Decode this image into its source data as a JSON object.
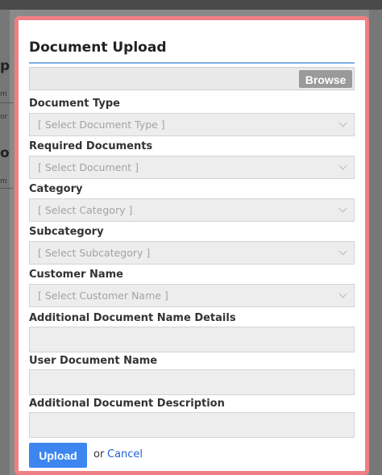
{
  "background": {
    "fragments": [
      "p",
      "o"
    ],
    "small_fragments": [
      "m",
      "or",
      "m"
    ]
  },
  "modal": {
    "title": "Document Upload",
    "file_input": {
      "value": "",
      "browse_label": "Browse"
    },
    "fields": [
      {
        "label": "Document Type",
        "kind": "select",
        "placeholder": "[ Select Document Type ]"
      },
      {
        "label": "Required Documents",
        "kind": "select",
        "placeholder": "[ Select Document ]"
      },
      {
        "label": "Category",
        "kind": "select",
        "placeholder": "[ Select Category ]"
      },
      {
        "label": "Subcategory",
        "kind": "select",
        "placeholder": "[ Select Subcategory ]"
      },
      {
        "label": "Customer Name",
        "kind": "select",
        "placeholder": "[ Select Customer Name ]"
      },
      {
        "label": "Additional Document Name Details",
        "kind": "text",
        "value": ""
      },
      {
        "label": "User Document Name",
        "kind": "text",
        "value": ""
      },
      {
        "label": "Additional Document Description",
        "kind": "text",
        "value": ""
      }
    ],
    "actions": {
      "upload_label": "Upload",
      "or_text": "or",
      "cancel_label": "Cancel"
    }
  },
  "colors": {
    "modal_border": "#f07f84",
    "title_rule": "#7fb2e6",
    "primary_button": "#3d86f0",
    "link": "#1f62d6",
    "browse_button": "#9a9a9a"
  }
}
